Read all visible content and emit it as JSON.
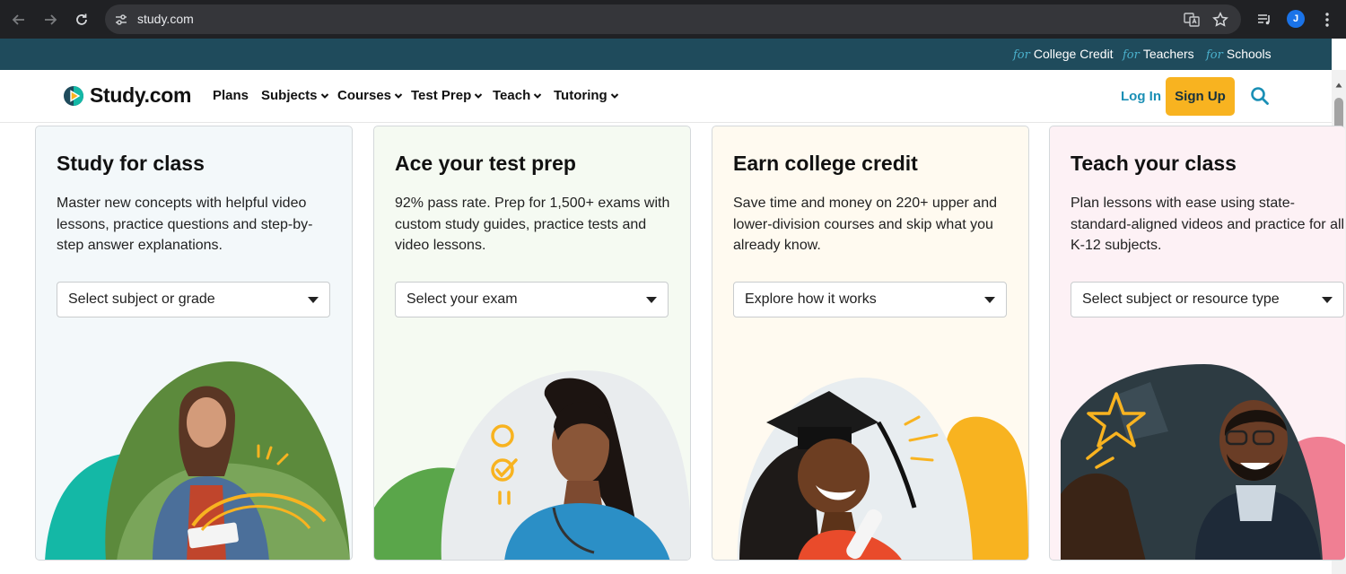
{
  "browser": {
    "url": "study.com",
    "profile_initial": "J"
  },
  "top_strip": {
    "links": [
      {
        "prefix": "for",
        "label": "College Credit"
      },
      {
        "prefix": "for",
        "label": "Teachers"
      },
      {
        "prefix": "for",
        "label": "Schools"
      }
    ]
  },
  "header": {
    "logo": "Study.com",
    "nav": [
      {
        "label": "Plans"
      },
      {
        "label": "Subjects"
      },
      {
        "label": "Courses"
      },
      {
        "label": "Test Prep"
      },
      {
        "label": "Teach"
      },
      {
        "label": "Tutoring"
      }
    ],
    "login_label": "Log In",
    "signup_label": "Sign Up"
  },
  "cards": [
    {
      "title": "Study for class",
      "description": "Master new concepts with helpful video lessons, practice questions and step-by-step answer explanations.",
      "select": "Select subject or grade",
      "bg": "#f3f8fa"
    },
    {
      "title": "Ace your test prep",
      "description": "92% pass rate. Prep for 1,500+ exams with custom study guides, practice tests and video lessons.",
      "select": "Select your exam",
      "bg": "#f5faf2"
    },
    {
      "title": "Earn college credit",
      "description": "Save time and money on 220+ upper and lower-division courses and skip what you already know.",
      "select": "Explore how it works",
      "bg": "#fffaf0"
    },
    {
      "title": "Teach your class",
      "description": "Plan lessons with ease using state-standard-aligned videos and practice for all K-12 subjects.",
      "select": "Select subject or resource type",
      "bg": "#fdf1f5"
    }
  ],
  "colors": {
    "strip_bg": "#1f4b5c",
    "accent_blue": "#1a8fb5",
    "signup_yellow": "#f8b320",
    "teal": "#14b8a6",
    "green": "#5aa64a",
    "orange": "#f8b320",
    "pink": "#f07f93"
  }
}
